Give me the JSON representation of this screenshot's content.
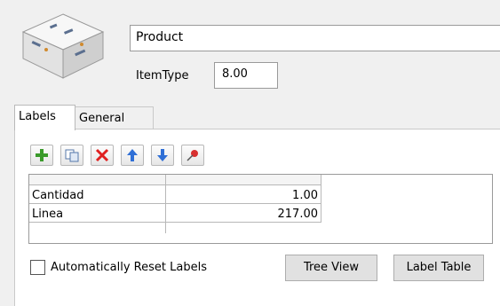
{
  "header": {
    "name_value": "Product",
    "itemtype_label": "ItemType",
    "itemtype_value": "8.00"
  },
  "tabs": [
    {
      "label": "Labels"
    },
    {
      "label": "General"
    }
  ],
  "toolbar": {
    "icons": [
      "add-icon",
      "duplicate-icon",
      "delete-icon",
      "move-up-icon",
      "move-down-icon",
      "pin-icon"
    ]
  },
  "labels_table": {
    "rows": [
      {
        "label": "Cantidad",
        "value": "1.00"
      },
      {
        "label": "Linea",
        "value": "217.00"
      }
    ]
  },
  "footer": {
    "checkbox_label": "Automatically Reset Labels",
    "tree_view_label": "Tree View",
    "label_table_label": "Label Table"
  }
}
